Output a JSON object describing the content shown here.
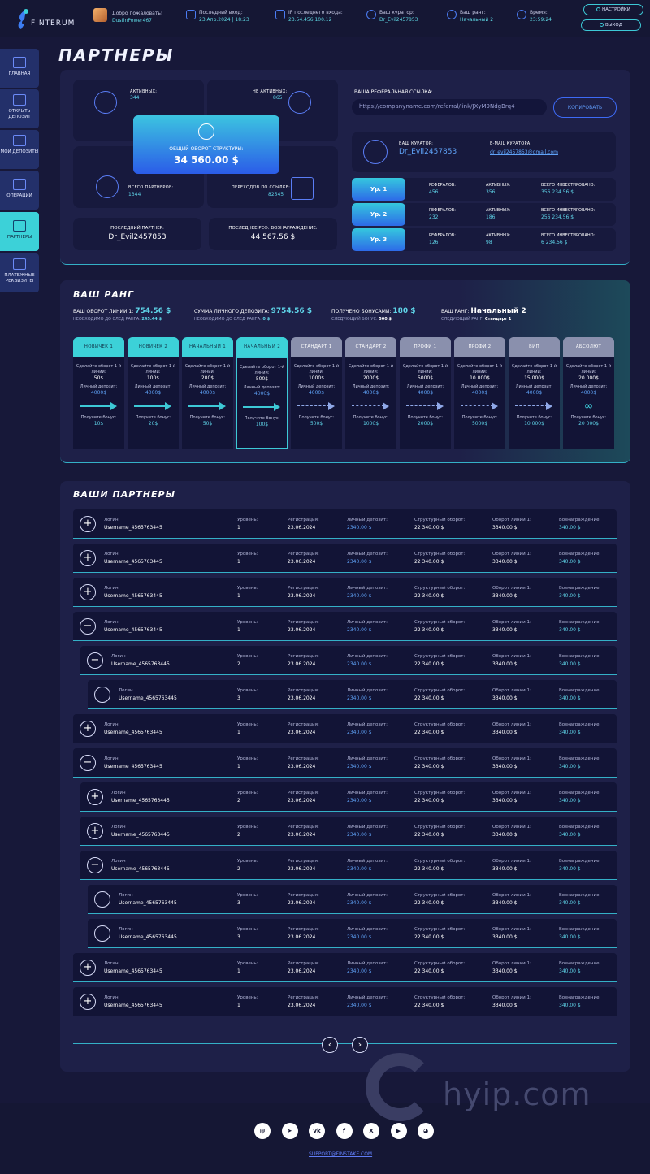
{
  "brand": {
    "name": "FINTERUM"
  },
  "header": {
    "welcome_label": "Добро пожаловать!",
    "username": "DustinPower467",
    "last_login_label": "Последний вход:",
    "last_login": "23.Апр.2024 | 18:23",
    "ip_label": "IP последнего входа:",
    "ip": "23.54.456.100.12",
    "curator_label": "Ваш куратор:",
    "curator": "Dr_Evil2457853",
    "rank_label": "Ваш ранг:",
    "rank": "Начальный 2",
    "time_label": "Время:",
    "time": "23:59:24",
    "settings_label": "НАСТРОЙКИ",
    "logout_label": "ВЫХОД"
  },
  "sidebar": {
    "items": [
      {
        "label": "ГЛАВНАЯ"
      },
      {
        "label": "ОТКРЫТЬ ДЕПОЗИТ"
      },
      {
        "label": "МОИ ДЕПОЗИТЫ"
      },
      {
        "label": "ОПЕРАЦИИ"
      },
      {
        "label": "ПАРТНЕРЫ"
      },
      {
        "label": "ПЛАТЕЖНЫЕ РЕКВИЗИТЫ"
      }
    ]
  },
  "page_title": "ПАРТНЕРЫ",
  "stats": {
    "active_label": "АКТИВНЫХ:",
    "active": "344",
    "inactive_label": "НЕ АКТИВНЫХ:",
    "inactive": "865",
    "turnover_label": "ОБЩИЙ ОБОРОТ СТРУКТУРЫ:",
    "turnover": "34 560.00 $",
    "total_label": "ВСЕГО ПАРТНЕРОВ:",
    "total": "1344",
    "clicks_label": "ПЕРЕХОДОВ ПО ССЫЛКЕ:",
    "clicks": "82545",
    "last_partner_label": "ПОСЛЕДНИЙ ПАРТНЕР:",
    "last_partner": "Dr_Evil2457853",
    "last_reward_label": "ПОСЛЕДНЕЕ РЕФ. ВОЗНАГРАЖДЕНИЕ:",
    "last_reward": "44 567.56 $"
  },
  "referral": {
    "label": "ВАША РЕФЕРАЛЬНАЯ ССЫЛКА:",
    "link": "https://companyname.com/referral/link/JXyM9NdgBrq4",
    "copy_label": "КОПИРОВАТЬ"
  },
  "curator_card": {
    "label": "ВАШ КУРАТОР:",
    "name": "Dr_Evil2457853",
    "email_label": "E-MAIL КУРАТОРА:",
    "email": "dr_evil2457853@gmail.com"
  },
  "levels": [
    {
      "label": "Ур. 1",
      "refs_label": "РЕФЕРАЛОВ:",
      "refs": "456",
      "active_label": "АКТИВНЫХ:",
      "active": "356",
      "invest_label": "ВСЕГО ИНВЕСТИРОВАНО:",
      "invest": "356 234.56 $"
    },
    {
      "label": "Ур. 2",
      "refs_label": "РЕФЕРАЛОВ:",
      "refs": "232",
      "active_label": "АКТИВНЫХ:",
      "active": "186",
      "invest_label": "ВСЕГО ИНВЕСТИРОВАНО:",
      "invest": "256 234.56 $"
    },
    {
      "label": "Ур. 3",
      "refs_label": "РЕФЕРАЛОВ:",
      "refs": "126",
      "active_label": "АКТИВНЫХ:",
      "active": "98",
      "invest_label": "ВСЕГО ИНВЕСТИРОВАНО:",
      "invest": "6 234.56 $"
    }
  ],
  "rank": {
    "title": "ВАШ РАНГ",
    "line_turnover_label": "ВАШ ОБОРОТ ЛИНИИ 1:",
    "line_turnover": "754.56 $",
    "line_need_label": "НЕОБХОДИМО ДО СЛЕД РАНГА:",
    "line_need": "245.44 $",
    "deposit_label": "СУММА ЛИЧНОГО ДЕПОЗИТА:",
    "deposit": "9754.56 $",
    "deposit_need_label": "НЕОБХОДИМО ДО СЛЕД РАНГА:",
    "deposit_need": "0 $",
    "bonus_label": "ПОЛУЧЕНО БОНУСАМИ:",
    "bonus": "180 $",
    "bonus_next_label": "СЛЕДУЮЩИЙ БОНУС:",
    "bonus_next": "500 $",
    "rank_label": "ВАШ РАНГ:",
    "rank": "Начальный 2",
    "next_rank_label": "СЛЕДУЮЩИЙ РАНГ:",
    "next_rank": "Стандарт 1",
    "req_label": "Сделайте оборот 1-й линии:",
    "dep_label": "Личный депозит:",
    "bonus_get_label": "Получите бонус:",
    "tiers": [
      {
        "name": "НОВИЧЕК 1",
        "turnover": "50$",
        "deposit": "4000$",
        "bonus": "10$",
        "state": "done"
      },
      {
        "name": "НОВИЧЕК 2",
        "turnover": "100$",
        "deposit": "4000$",
        "bonus": "20$",
        "state": "done"
      },
      {
        "name": "НАЧАЛЬНЫЙ 1",
        "turnover": "200$",
        "deposit": "4000$",
        "bonus": "50$",
        "state": "done"
      },
      {
        "name": "НАЧАЛЬНЫЙ 2",
        "turnover": "500$",
        "deposit": "4000$",
        "bonus": "100$",
        "state": "current"
      },
      {
        "name": "СТАНДАРТ 1",
        "turnover": "1000$",
        "deposit": "4000$",
        "bonus": "500$",
        "state": "locked"
      },
      {
        "name": "СТАНДАРТ 2",
        "turnover": "2000$",
        "deposit": "4000$",
        "bonus": "1000$",
        "state": "locked"
      },
      {
        "name": "ПРОФИ 1",
        "turnover": "5000$",
        "deposit": "4000$",
        "bonus": "2000$",
        "state": "locked"
      },
      {
        "name": "ПРОФИ 2",
        "turnover": "10 000$",
        "deposit": "4000$",
        "bonus": "5000$",
        "state": "locked"
      },
      {
        "name": "ВИП",
        "turnover": "15 000$",
        "deposit": "4000$",
        "bonus": "10 000$",
        "state": "locked"
      },
      {
        "name": "АБСОЛЮТ",
        "turnover": "20 000$",
        "deposit": "4000$",
        "bonus": "20 000$",
        "state": "final"
      }
    ]
  },
  "partners": {
    "title": "ВАШИ ПАРТНЕРЫ",
    "col_login": "Логин",
    "col_level": "Уровень:",
    "col_reg": "Регистрация:",
    "col_dep": "Личный депозит:",
    "col_struct": "Структурный оборот:",
    "col_line": "Оборот линии 1:",
    "col_reward": "Вознаграждение:",
    "rows": [
      {
        "toggle": "+",
        "indent": 0,
        "login": "Username_4565763445",
        "level": "1",
        "reg": "23.06.2024",
        "dep": "2340.00 $",
        "struct": "22 340.00 $",
        "line": "3340.00 $",
        "reward": "340.00 $"
      },
      {
        "toggle": "+",
        "indent": 0,
        "login": "Username_4565763445",
        "level": "1",
        "reg": "23.06.2024",
        "dep": "2340.00 $",
        "struct": "22 340.00 $",
        "line": "3340.00 $",
        "reward": "340.00 $"
      },
      {
        "toggle": "+",
        "indent": 0,
        "login": "Username_4565763445",
        "level": "1",
        "reg": "23.06.2024",
        "dep": "2340.00 $",
        "struct": "22 340.00 $",
        "line": "3340.00 $",
        "reward": "340.00 $"
      },
      {
        "toggle": "−",
        "indent": 0,
        "login": "Username_4565763445",
        "level": "1",
        "reg": "23.06.2024",
        "dep": "2340.00 $",
        "struct": "22 340.00 $",
        "line": "3340.00 $",
        "reward": "340.00 $"
      },
      {
        "toggle": "−",
        "indent": 1,
        "login": "Username_4565763445",
        "level": "2",
        "reg": "23.06.2024",
        "dep": "2340.00 $",
        "struct": "22 340.00 $",
        "line": "3340.00 $",
        "reward": "340.00 $"
      },
      {
        "toggle": "",
        "indent": 2,
        "login": "Username_4565763445",
        "level": "3",
        "reg": "23.06.2024",
        "dep": "2340.00 $",
        "struct": "22 340.00 $",
        "line": "3340.00 $",
        "reward": "340.00 $"
      },
      {
        "toggle": "+",
        "indent": 0,
        "login": "Username_4565763445",
        "level": "1",
        "reg": "23.06.2024",
        "dep": "2340.00 $",
        "struct": "22 340.00 $",
        "line": "3340.00 $",
        "reward": "340.00 $"
      },
      {
        "toggle": "−",
        "indent": 0,
        "login": "Username_4565763445",
        "level": "1",
        "reg": "23.06.2024",
        "dep": "2340.00 $",
        "struct": "22 340.00 $",
        "line": "3340.00 $",
        "reward": "340.00 $"
      },
      {
        "toggle": "+",
        "indent": 1,
        "login": "Username_4565763445",
        "level": "2",
        "reg": "23.06.2024",
        "dep": "2340.00 $",
        "struct": "22 340.00 $",
        "line": "3340.00 $",
        "reward": "340.00 $"
      },
      {
        "toggle": "+",
        "indent": 1,
        "login": "Username_4565763445",
        "level": "2",
        "reg": "23.06.2024",
        "dep": "2340.00 $",
        "struct": "22 340.00 $",
        "line": "3340.00 $",
        "reward": "340.00 $"
      },
      {
        "toggle": "−",
        "indent": 1,
        "login": "Username_4565763445",
        "level": "2",
        "reg": "23.06.2024",
        "dep": "2340.00 $",
        "struct": "22 340.00 $",
        "line": "3340.00 $",
        "reward": "340.00 $"
      },
      {
        "toggle": "",
        "indent": 2,
        "login": "Username_4565763445",
        "level": "3",
        "reg": "23.06.2024",
        "dep": "2340.00 $",
        "struct": "22 340.00 $",
        "line": "3340.00 $",
        "reward": "340.00 $"
      },
      {
        "toggle": "",
        "indent": 2,
        "login": "Username_4565763445",
        "level": "3",
        "reg": "23.06.2024",
        "dep": "2340.00 $",
        "struct": "22 340.00 $",
        "line": "3340.00 $",
        "reward": "340.00 $"
      },
      {
        "toggle": "+",
        "indent": 0,
        "login": "Username_4565763445",
        "level": "1",
        "reg": "23.06.2024",
        "dep": "2340.00 $",
        "struct": "22 340.00 $",
        "line": "3340.00 $",
        "reward": "340.00 $"
      },
      {
        "toggle": "+",
        "indent": 0,
        "login": "Username_4565763445",
        "level": "1",
        "reg": "23.06.2024",
        "dep": "2340.00 $",
        "struct": "22 340.00 $",
        "line": "3340.00 $",
        "reward": "340.00 $"
      }
    ],
    "prev": "‹",
    "next": "›"
  },
  "footer": {
    "socials": [
      {
        "icon": "email-icon",
        "glyph": "@"
      },
      {
        "icon": "telegram-icon",
        "glyph": "➤"
      },
      {
        "icon": "vk-icon",
        "glyph": "vk"
      },
      {
        "icon": "facebook-icon",
        "glyph": "f"
      },
      {
        "icon": "x-icon",
        "glyph": "X"
      },
      {
        "icon": "youtube-icon",
        "glyph": "▶"
      },
      {
        "icon": "discord-icon",
        "glyph": "◕"
      }
    ],
    "email": "SUPPORT@FINSTAKE.COM",
    "watermark": "hyip.com"
  },
  "colors": {
    "accent": "#3cd1d8",
    "primary": "#2d6ae8",
    "bg": "#171839"
  }
}
